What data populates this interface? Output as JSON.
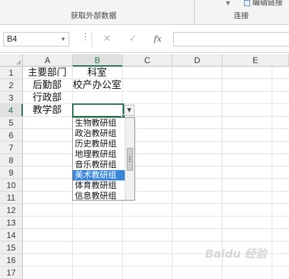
{
  "ribbon": {
    "group_external": "获取外部数据",
    "group_connections": "连接",
    "edit_links": "编辑链接"
  },
  "formula_bar": {
    "name_box": "B4",
    "cancel_icon": "✕",
    "enter_icon": "✓",
    "fx_label": "fx",
    "formula": ""
  },
  "columns": [
    "A",
    "B",
    "C",
    "D",
    "E"
  ],
  "rows": [
    "1",
    "2",
    "3",
    "4",
    "5",
    "6",
    "7",
    "8",
    "9",
    "10",
    "11",
    "12",
    "13",
    "14",
    "15",
    "16",
    "17"
  ],
  "cells": {
    "A1": "主要部门",
    "B1": "科室",
    "A2": "后勤部",
    "B2": "校产办公室",
    "A3": "行政部",
    "A4": "教学部"
  },
  "active_cell": "B4",
  "dropdown": {
    "items": [
      "生物教研组",
      "政治教研组",
      "历史教研组",
      "地理教研组",
      "音乐教研组",
      "美术教研组",
      "体育教研组",
      "信息教研组"
    ],
    "highlighted": "美术教研组"
  },
  "watermark": "Baidu 经验"
}
